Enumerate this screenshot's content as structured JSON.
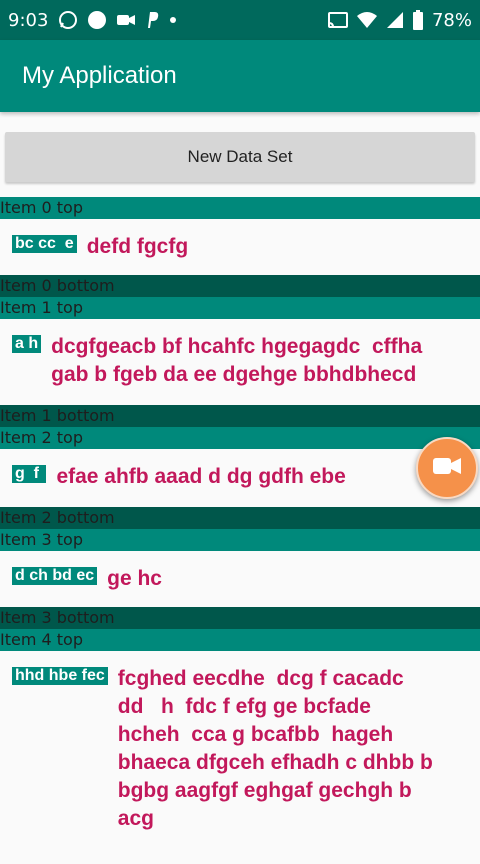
{
  "status_bar": {
    "time": "9:03",
    "battery": "78%",
    "left_icons": [
      "whatsapp-icon",
      "circle-icon",
      "video-camera-icon",
      "paypal-icon",
      "dot-icon"
    ],
    "right_icons": [
      "cast-icon",
      "wifi-icon",
      "signal-icon",
      "battery-icon"
    ]
  },
  "app_bar": {
    "title": "My Application"
  },
  "toolbar": {
    "new_data_set_label": "New Data Set"
  },
  "items": [
    {
      "top": "Item 0 top",
      "tag": "bc cc  e",
      "text": "defd fgcfg",
      "bottom": "Item 0 bottom"
    },
    {
      "top": "Item 1 top",
      "tag": "a h",
      "text": "dcgfgeacb bf hcahfc hgegagdc  cffha\ngab b fgeb da ee dgehge bbhdbhecd",
      "bottom": "Item 1 bottom"
    },
    {
      "top": "Item 2 top",
      "tag": "g  f ",
      "text": "efae ahfb aaad d dg gdfh ebe",
      "bottom": "Item 2 bottom"
    },
    {
      "top": "Item 3 top",
      "tag": "d ch bd ec",
      "text": "ge hc",
      "bottom": "Item 3 bottom"
    },
    {
      "top": "Item 4 top",
      "tag": "hhd hbe fec",
      "text": "fcghed eecdhe  dcg f cacadc\ndd   h  fdc f efg ge bcfade\nhcheh  cca g bcafbb  hageh\nbhaeca dfgceh efhadh c dhbb b\nbgbg aagfgf eghgaf gechgh b\nacg"
    }
  ],
  "fab": {
    "icon": "video-camera-icon"
  },
  "colors": {
    "status_bar": "#00695c",
    "app_bar": "#00897b",
    "item_top": "#00897b",
    "item_bottom": "#00574b",
    "accent_text": "#c2185b",
    "fab": "#f5914a"
  }
}
